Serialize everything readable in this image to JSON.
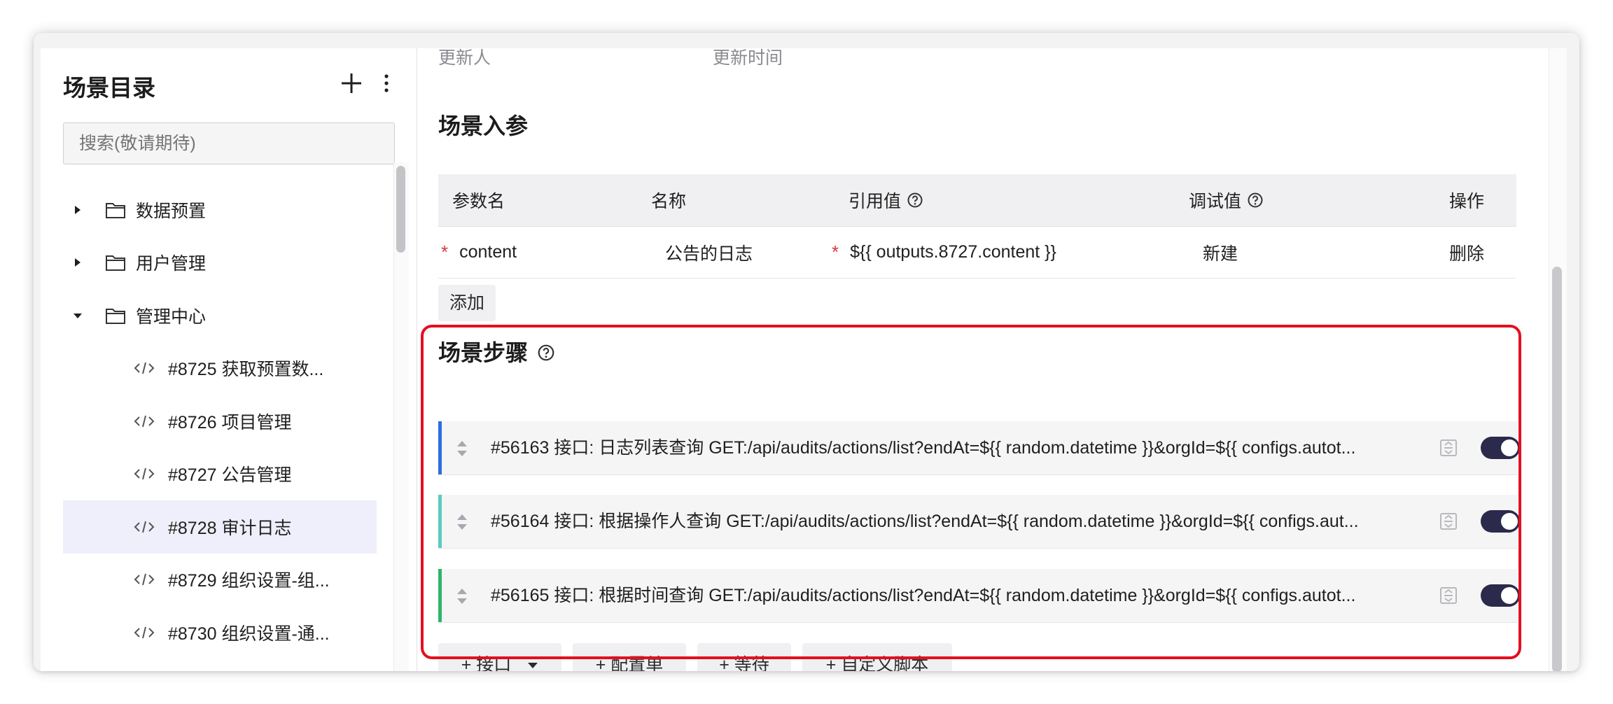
{
  "sidebar": {
    "title": "场景目录",
    "search_placeholder": "搜索(敬请期待)",
    "items": [
      {
        "label": "数据预置",
        "type": "folder",
        "expanded": false
      },
      {
        "label": "用户管理",
        "type": "folder",
        "expanded": false
      },
      {
        "label": "管理中心",
        "type": "folder",
        "expanded": true
      },
      {
        "label": "#8725 获取预置数...",
        "type": "scene"
      },
      {
        "label": "#8726 项目管理",
        "type": "scene"
      },
      {
        "label": "#8727 公告管理",
        "type": "scene"
      },
      {
        "label": "#8728 审计日志",
        "type": "scene",
        "selected": true
      },
      {
        "label": "#8729 组织设置-组...",
        "type": "scene"
      },
      {
        "label": "#8730 组织设置-通...",
        "type": "scene"
      }
    ]
  },
  "main": {
    "cut_labels": {
      "updater": "更新人",
      "update_time": "更新时间"
    },
    "params_title": "场景入参",
    "params_table": {
      "headers": {
        "param_name": "参数名",
        "name": "名称",
        "ref_value": "引用值",
        "debug_value": "调试值",
        "action": "操作"
      },
      "rows": [
        {
          "param_name": "content",
          "name": "公告的日志",
          "ref_value": "${{ outputs.8727.content }}",
          "debug_value": "新建",
          "action": "删除"
        }
      ]
    },
    "add_label": "添加",
    "steps_title": "场景步骤",
    "steps": [
      {
        "text": "#56163 接口: 日志列表查询 GET:/api/audits/actions/list?endAt=${{ random.datetime }}&orgId=${{ configs.autot...",
        "color": "#2d6ee0",
        "enabled": true
      },
      {
        "text": "#56164 接口: 根据操作人查询 GET:/api/audits/actions/list?endAt=${{ random.datetime }}&orgId=${{ configs.aut...",
        "color": "#5ccbbf",
        "enabled": true
      },
      {
        "text": "#56165 接口: 根据时间查询 GET:/api/audits/actions/list?endAt=${{ random.datetime }}&orgId=${{ configs.autot...",
        "color": "#2fb56a",
        "enabled": true
      }
    ],
    "step_buttons": {
      "api": "+ 接口",
      "config": "+ 配置单",
      "wait": "+ 等待",
      "script": "+ 自定义脚本"
    },
    "highlight_color": "#e3101f"
  }
}
